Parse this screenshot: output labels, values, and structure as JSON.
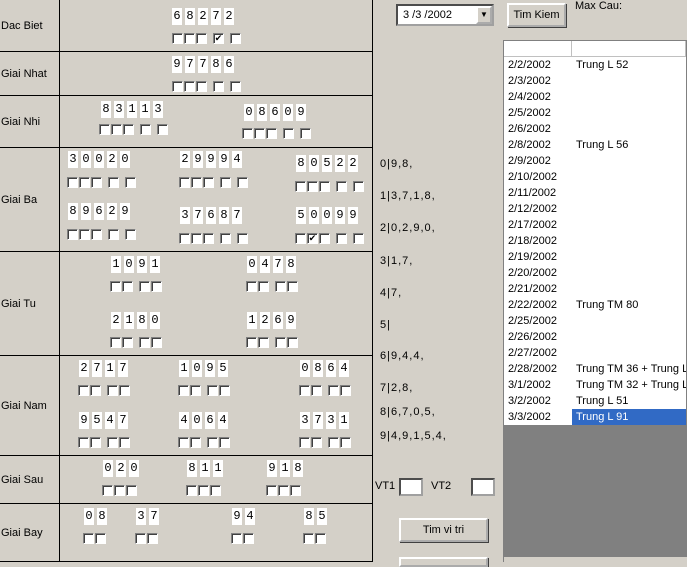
{
  "prizes": [
    {
      "label": "Dac Biet",
      "numbers": [
        {
          "digits": [
            "6",
            "8",
            "2",
            "7",
            "2"
          ],
          "checks": [
            false,
            false,
            false,
            true,
            false
          ]
        }
      ]
    },
    {
      "label": "Giai Nhat",
      "numbers": [
        {
          "digits": [
            "9",
            "7",
            "7",
            "8",
            "6"
          ],
          "checks": [
            false,
            false,
            false,
            false,
            false
          ]
        }
      ]
    },
    {
      "label": "Giai Nhi",
      "numbers": [
        {
          "digits": [
            "8",
            "3",
            "1",
            "1",
            "3"
          ],
          "checks": [
            false,
            false,
            false,
            false,
            false
          ]
        },
        {
          "digits": [
            "0",
            "8",
            "6",
            "0",
            "9"
          ],
          "checks": [
            false,
            false,
            false,
            false,
            false
          ]
        }
      ]
    },
    {
      "label": "Giai Ba",
      "numbers": [
        {
          "digits": [
            "3",
            "0",
            "0",
            "2",
            "0"
          ],
          "checks": [
            false,
            false,
            false,
            false,
            false
          ]
        },
        {
          "digits": [
            "2",
            "9",
            "9",
            "9",
            "4"
          ],
          "checks": [
            false,
            false,
            false,
            false,
            false
          ]
        },
        {
          "digits": [
            "8",
            "0",
            "5",
            "2",
            "2"
          ],
          "checks": [
            false,
            false,
            false,
            false,
            false
          ]
        },
        {
          "digits": [
            "8",
            "9",
            "6",
            "2",
            "9"
          ],
          "checks": [
            false,
            false,
            false,
            false,
            false
          ]
        },
        {
          "digits": [
            "3",
            "7",
            "6",
            "8",
            "7"
          ],
          "checks": [
            false,
            false,
            false,
            false,
            false
          ]
        },
        {
          "digits": [
            "5",
            "0",
            "0",
            "9",
            "9"
          ],
          "checks": [
            false,
            true,
            false,
            false,
            false
          ]
        }
      ]
    },
    {
      "label": "Giai Tu",
      "numbers": [
        {
          "digits": [
            "1",
            "0",
            "9",
            "1"
          ]
        },
        {
          "digits": [
            "0",
            "4",
            "7",
            "8"
          ]
        },
        {
          "digits": [
            "2",
            "1",
            "8",
            "0"
          ]
        },
        {
          "digits": [
            "1",
            "2",
            "6",
            "9"
          ]
        }
      ]
    },
    {
      "label": "Giai Nam",
      "numbers": [
        {
          "digits": [
            "2",
            "7",
            "1",
            "7"
          ]
        },
        {
          "digits": [
            "1",
            "0",
            "9",
            "5"
          ]
        },
        {
          "digits": [
            "0",
            "8",
            "6",
            "4"
          ]
        },
        {
          "digits": [
            "9",
            "5",
            "4",
            "7"
          ]
        },
        {
          "digits": [
            "4",
            "0",
            "6",
            "4"
          ]
        },
        {
          "digits": [
            "3",
            "7",
            "3",
            "1"
          ]
        }
      ]
    },
    {
      "label": "Giai Sau",
      "numbers": [
        {
          "digits": [
            "0",
            "2",
            "0"
          ]
        },
        {
          "digits": [
            "8",
            "1",
            "1"
          ]
        },
        {
          "digits": [
            "9",
            "1",
            "8"
          ]
        }
      ]
    },
    {
      "label": "Giai Bay",
      "numbers": [
        {
          "digits": [
            "0",
            "8"
          ]
        },
        {
          "digits": [
            "3",
            "7"
          ]
        },
        {
          "digits": [
            "9",
            "4"
          ]
        },
        {
          "digits": [
            "8",
            "5"
          ]
        }
      ]
    }
  ],
  "side_lines": [
    "0|9,8,",
    "1|3,7,1,8,",
    "2|0,2,9,0,",
    "3|1,7,",
    "4|7,",
    "5|",
    "6|9,4,4,",
    "7|2,8,",
    "8|6,7,0,5,",
    "9|4,9,1,5,4,"
  ],
  "controls": {
    "date": "3 /3 /2002",
    "search_button": "Tim Kiem",
    "max_cau_label": "Max Cau:",
    "vt1_label": "VT1",
    "vt2_label": "VT2",
    "find_pos_button": "Tim vi tri"
  },
  "results": [
    [
      "2/2/2002",
      "Trung L 52"
    ],
    [
      "2/3/2002",
      ""
    ],
    [
      "2/4/2002",
      ""
    ],
    [
      "2/5/2002",
      ""
    ],
    [
      "2/6/2002",
      ""
    ],
    [
      "2/8/2002",
      "Trung L 56"
    ],
    [
      "2/9/2002",
      ""
    ],
    [
      "2/10/2002",
      ""
    ],
    [
      "2/11/2002",
      ""
    ],
    [
      "2/12/2002",
      ""
    ],
    [
      "2/17/2002",
      ""
    ],
    [
      "2/18/2002",
      ""
    ],
    [
      "2/19/2002",
      ""
    ],
    [
      "2/20/2002",
      ""
    ],
    [
      "2/21/2002",
      ""
    ],
    [
      "2/22/2002",
      "Trung TM 80"
    ],
    [
      "2/25/2002",
      ""
    ],
    [
      "2/26/2002",
      ""
    ],
    [
      "2/27/2002",
      ""
    ],
    [
      "2/28/2002",
      "Trung TM 36 + Trung L"
    ],
    [
      "3/1/2002",
      "Trung TM 32 + Trung L"
    ],
    [
      "3/2/2002",
      "Trung L 51"
    ],
    [
      "3/3/2002",
      "Trung L 91"
    ]
  ],
  "selected_row": 22
}
